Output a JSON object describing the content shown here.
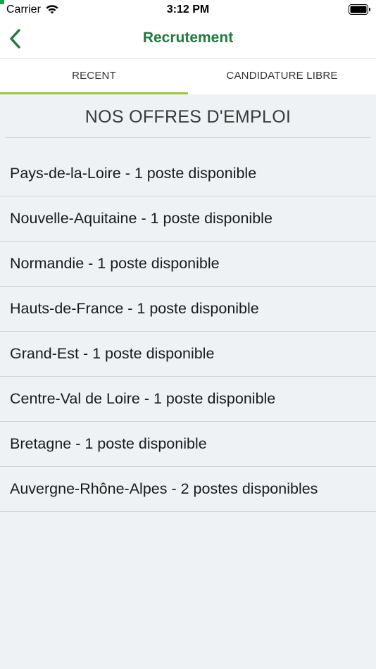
{
  "status_bar": {
    "carrier": "Carrier",
    "time": "3:12 PM"
  },
  "nav": {
    "title": "Recrutement",
    "back_icon": "chevron-left-icon",
    "accent_color": "#1f7a3c"
  },
  "tabs": [
    {
      "label": "RECENT",
      "active": true
    },
    {
      "label": "CANDIDATURE LIBRE",
      "active": false
    }
  ],
  "tab_indicator_color": "#9cc83a",
  "section": {
    "title": "NOS OFFRES D'EMPLOI"
  },
  "offers": [
    {
      "label": "Pays-de-la-Loire - 1 poste disponible"
    },
    {
      "label": "Nouvelle-Aquitaine - 1 poste disponible"
    },
    {
      "label": "Normandie - 1 poste disponible"
    },
    {
      "label": "Hauts-de-France - 1 poste disponible"
    },
    {
      "label": "Grand-Est - 1 poste disponible"
    },
    {
      "label": "Centre-Val de Loire - 1 poste disponible"
    },
    {
      "label": "Bretagne - 1 poste disponible"
    },
    {
      "label": "Auvergne-Rhône-Alpes - 2 postes disponibles"
    }
  ]
}
